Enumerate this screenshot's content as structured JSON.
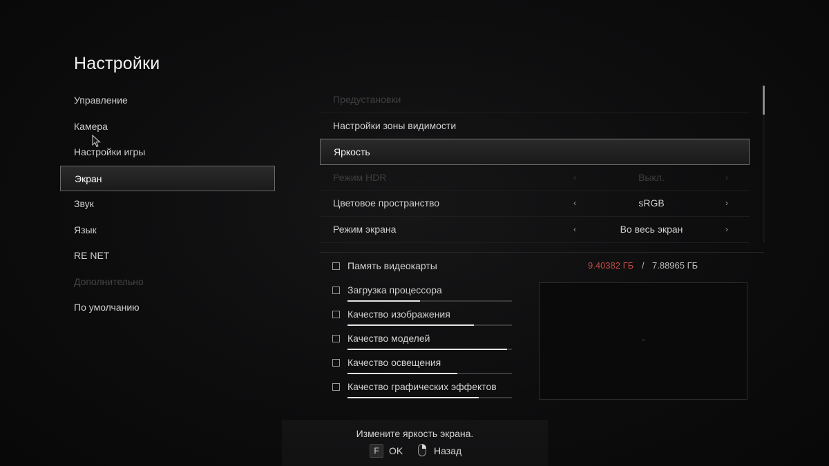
{
  "title": "Настройки",
  "menu": {
    "items": [
      {
        "label": "Управление",
        "state": "normal"
      },
      {
        "label": "Камера",
        "state": "normal"
      },
      {
        "label": "Настройки игры",
        "state": "normal"
      },
      {
        "label": "Экран",
        "state": "selected"
      },
      {
        "label": "Звук",
        "state": "normal"
      },
      {
        "label": "Язык",
        "state": "normal"
      },
      {
        "label": "RE NET",
        "state": "normal"
      },
      {
        "label": "Дополнительно",
        "state": "disabled"
      },
      {
        "label": "По умолчанию",
        "state": "normal"
      }
    ]
  },
  "settings": {
    "rows": [
      {
        "label": "Предустановки",
        "state": "disabled"
      },
      {
        "label": "Настройки зоны видимости",
        "state": "normal"
      },
      {
        "label": "Яркость",
        "state": "selected"
      },
      {
        "label": "Режим HDR",
        "value": "Выкл.",
        "state": "disabled"
      },
      {
        "label": "Цветовое пространство",
        "value": "sRGB",
        "state": "normal"
      },
      {
        "label": "Режим экрана",
        "value": "Во весь экран",
        "state": "normal"
      }
    ],
    "arrow_left": "‹",
    "arrow_right": "›"
  },
  "memory": {
    "label": "Память видеокарты",
    "used": "9.40382 ГБ",
    "separator": "/",
    "total": "7.88965 ГБ",
    "used_color": "#c04a45"
  },
  "quality": [
    {
      "label": "Загрузка процессора",
      "level": 0.44
    },
    {
      "label": "Качество изображения",
      "level": 0.77
    },
    {
      "label": "Качество моделей",
      "level": 0.97
    },
    {
      "label": "Качество освещения",
      "level": 0.67
    },
    {
      "label": "Качество графических эффектов",
      "level": 0.8
    }
  ],
  "footer": {
    "hint": "Измените яркость экрана.",
    "ok_key": "F",
    "ok_label": "OK",
    "back_label": "Назад"
  }
}
